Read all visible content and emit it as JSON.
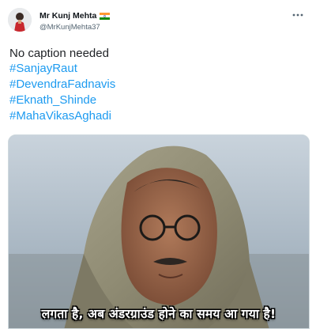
{
  "tweet": {
    "author": {
      "display_name": "Mr Kunj Mehta",
      "handle": "@MrKunjMehta37",
      "badge_icon": "india-flag-icon"
    },
    "more_icon": "more-options-icon",
    "caption": "No caption needed",
    "hashtags": [
      "#SanjayRaut",
      "#DevendraFadnavis",
      "#Eknath_Shinde",
      "#MahaVikasAghadi"
    ],
    "media": {
      "subtitle": "लगता है, अब अंडरग्राउंड होने का समय आ गया है!"
    },
    "colors": {
      "hashtag": "#1d9bf0",
      "text": "#0f1419",
      "secondary": "#536471",
      "border": "#cfd9de"
    }
  }
}
